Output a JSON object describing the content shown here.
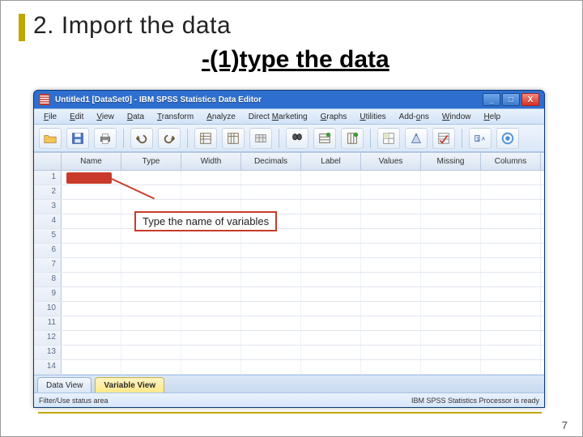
{
  "slide": {
    "title": "2. Import the data",
    "subtitle": "-(1)type the data",
    "number": "7"
  },
  "window": {
    "title": "Untitled1 [DataSet0] - IBM SPSS Statistics Data Editor",
    "controls": {
      "min": "_",
      "max": "□",
      "close": "X"
    }
  },
  "menubar": {
    "file": "File",
    "edit": "Edit",
    "view": "View",
    "data": "Data",
    "transform": "Transform",
    "analyze": "Analyze",
    "directm": "Direct Marketing",
    "graphs": "Graphs",
    "utilities": "Utilities",
    "addons": "Add-ons",
    "window": "Window",
    "help": "Help"
  },
  "columns": {
    "name": "Name",
    "type": "Type",
    "width": "Width",
    "decimals": "Decimals",
    "label": "Label",
    "values": "Values",
    "missing": "Missing",
    "cols": "Columns"
  },
  "rows": [
    "1",
    "2",
    "3",
    "4",
    "5",
    "6",
    "7",
    "8",
    "9",
    "10",
    "11",
    "12",
    "13",
    "14"
  ],
  "callout": {
    "text": "Type the name of variables"
  },
  "tabs": {
    "data": "Data View",
    "var": "Variable View"
  },
  "status": {
    "left": "Filter/Use status area",
    "right": "IBM SPSS Statistics Processor is ready"
  }
}
